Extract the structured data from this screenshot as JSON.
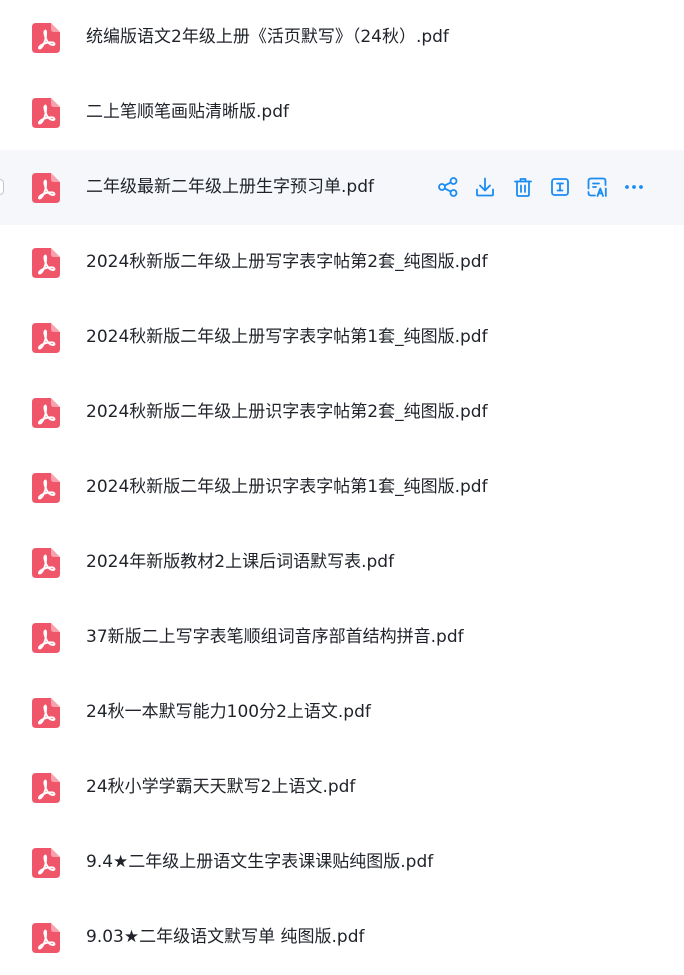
{
  "colors": {
    "pdf_icon": "#f0566a",
    "action_icon": "#1a8cf2",
    "hover_row_bg": "#f5f7fb",
    "text": "#1f2329"
  },
  "files": [
    {
      "name": "统编版语文2年级上册《活页默写》（24秋）.pdf",
      "icon": "pdf-icon"
    },
    {
      "name": "二上笔顺笔画贴清晰版.pdf",
      "icon": "pdf-icon"
    },
    {
      "name": "二年级最新二年级上册生字预习单.pdf",
      "icon": "pdf-icon",
      "hovered": true
    },
    {
      "name": "2024秋新版二年级上册写字表字帖第2套_纯图版.pdf",
      "icon": "pdf-icon"
    },
    {
      "name": "2024秋新版二年级上册写字表字帖第1套_纯图版.pdf",
      "icon": "pdf-icon"
    },
    {
      "name": "2024秋新版二年级上册识字表字帖第2套_纯图版.pdf",
      "icon": "pdf-icon"
    },
    {
      "name": "2024秋新版二年级上册识字表字帖第1套_纯图版.pdf",
      "icon": "pdf-icon"
    },
    {
      "name": "2024年新版教材2上课后词语默写表.pdf",
      "icon": "pdf-icon"
    },
    {
      "name": "37新版二上写字表笔顺组词音序部首结构拼音.pdf",
      "icon": "pdf-icon"
    },
    {
      "name": "24秋一本默写能力100分2上语文.pdf",
      "icon": "pdf-icon"
    },
    {
      "name": "24秋小学学霸天天默写2上语文.pdf",
      "icon": "pdf-icon"
    },
    {
      "name": "9.4★二年级上册语文生字表课课贴纯图版.pdf",
      "icon": "pdf-icon"
    },
    {
      "name": "9.03★二年级语文默写单 纯图版.pdf",
      "icon": "pdf-icon"
    }
  ],
  "hover_actions": [
    {
      "icon": "share-icon"
    },
    {
      "icon": "download-icon"
    },
    {
      "icon": "delete-icon"
    },
    {
      "icon": "rename-icon"
    },
    {
      "icon": "ai-scan-icon"
    },
    {
      "icon": "more-icon"
    }
  ]
}
